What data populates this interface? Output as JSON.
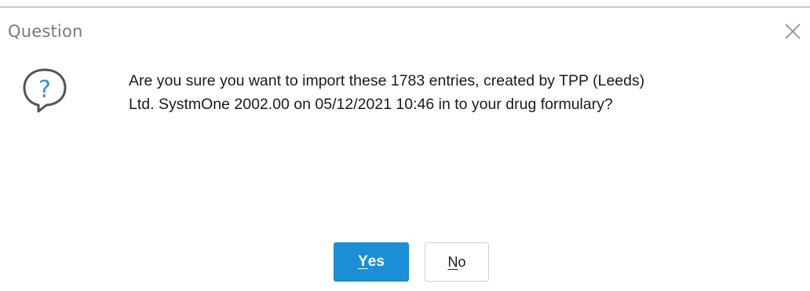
{
  "dialog": {
    "title": "Question",
    "icon": "question-bubble-icon",
    "message_line1": "Are you sure you want to import these 1783 entries, created by TPP (Leeds)",
    "message_line2": "Ltd. SystmOne 2002.00 on 05/12/2021 10:46 in to your drug formulary?",
    "close_icon": "close-icon"
  },
  "buttons": {
    "yes": {
      "mnemonic": "Y",
      "rest": "es"
    },
    "no": {
      "mnemonic": "N",
      "rest": "o"
    }
  },
  "colors": {
    "primary_button": "#1a8fd6",
    "title_text": "#7a7a7a",
    "icon_stroke": "#555555",
    "icon_glyph": "#3a8fd0"
  }
}
